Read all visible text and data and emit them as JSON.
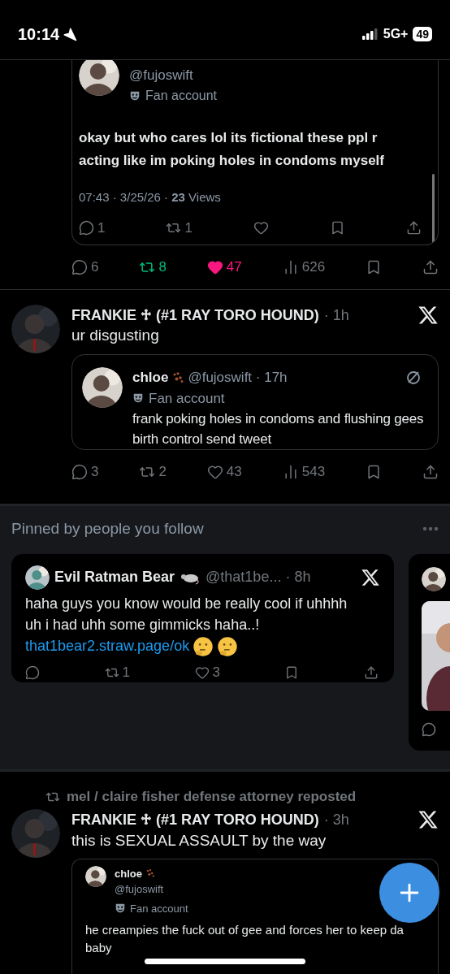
{
  "status_bar": {
    "time": "10:14",
    "network": "5G+",
    "battery": "49"
  },
  "top_tweet": {
    "quote": {
      "handle": "@fujoswift",
      "badge": "Fan account",
      "text": "okay but who cares lol its fictional these ppl r acting like im poking holes in condoms myself",
      "meta": "07:43 · 3/25/26 · **23** Views",
      "stats": [
        {
          "kind": "reply",
          "count": "1"
        },
        {
          "kind": "repost",
          "count": "1"
        },
        {
          "kind": "like"
        },
        {
          "kind": "bookmark"
        },
        {
          "kind": "share"
        }
      ]
    },
    "stats": [
      {
        "kind": "reply",
        "count": "6"
      },
      {
        "kind": "repost",
        "count": "8",
        "active": true
      },
      {
        "kind": "like",
        "count": "47",
        "active": true
      },
      {
        "kind": "views",
        "count": "626"
      },
      {
        "kind": "bookmark"
      },
      {
        "kind": "share"
      }
    ]
  },
  "tweet": {
    "name": "FRANKIE ♱ (#1 RAY TORO HOUND)",
    "time": "· 1h",
    "text": "ur disgusting",
    "quote": {
      "name": "chloe",
      "handle": "@fujoswift · 17h",
      "badge": "Fan account",
      "text": "frank poking holes in condoms and flushing gees birth control send tweet"
    },
    "stats": [
      {
        "kind": "reply",
        "count": "3"
      },
      {
        "kind": "repost",
        "count": "2",
        "active": false
      },
      {
        "kind": "like",
        "count": "43",
        "active": false
      },
      {
        "kind": "views",
        "count": "543"
      },
      {
        "kind": "bookmark"
      },
      {
        "kind": "share"
      }
    ]
  },
  "pinned": {
    "title": "Pinned by people you follow",
    "cards": [
      {
        "name": "Evil Ratman Bear",
        "handle": "@that1be... · 8h",
        "text": "haha guys you know would be really cool if uhhhh uh i had uhh some gimmicks haha..!",
        "link": "that1bear2.straw.page/ok",
        "stats": [
          {
            "kind": "reply"
          },
          {
            "kind": "repost",
            "count": "1",
            "active": false
          },
          {
            "kind": "like",
            "count": "3",
            "active": false
          },
          {
            "kind": "bookmark"
          },
          {
            "kind": "share"
          }
        ]
      }
    ]
  },
  "repost_tweet": {
    "reposted_by": "mel / claire fisher defense attorney reposted",
    "name": "FRANKIE ♱ (#1 RAY TORO HOUND)",
    "time": "· 3h",
    "text": "this is SEXUAL ASSAULT by the way",
    "quote": {
      "name": "chloe",
      "handle": "@fujoswift",
      "badge": "Fan account",
      "text": "he creampies the fuck out of gee and forces her to keep da baby"
    }
  }
}
